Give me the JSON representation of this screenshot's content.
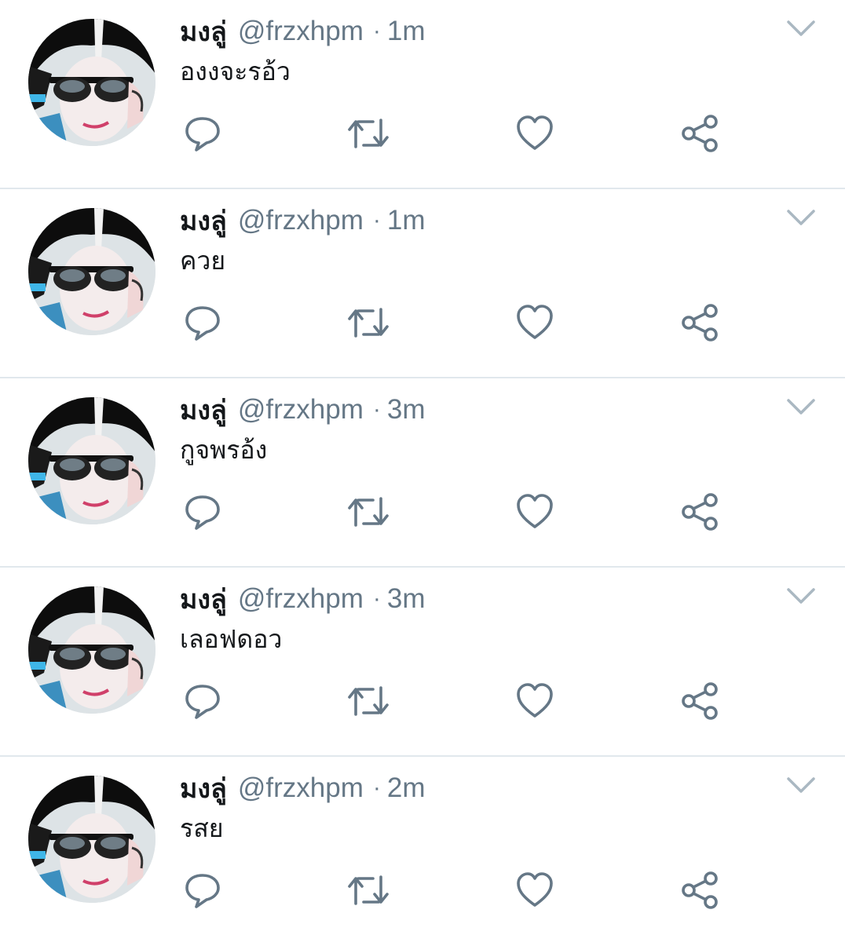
{
  "colors": {
    "name": "#14171a",
    "meta": "#657786",
    "icon": "#657786",
    "divider": "#e1e8ed",
    "caret": "#aab8c2"
  },
  "icons": {
    "reply": "reply-icon",
    "retweet": "retweet-icon",
    "like": "heart-icon",
    "share": "share-icon",
    "caret": "chevron-down-icon"
  },
  "tweets": [
    {
      "name": "มงลู่",
      "handle": "@frzxhpm",
      "separator": "·",
      "time": "1m",
      "text": "องงจะรอ้ว"
    },
    {
      "name": "มงลู่",
      "handle": "@frzxhpm",
      "separator": "·",
      "time": "1m",
      "text": "ควย"
    },
    {
      "name": "มงลู่",
      "handle": "@frzxhpm",
      "separator": "·",
      "time": "3m",
      "text": "กูจพรอ้ง"
    },
    {
      "name": "มงลู่",
      "handle": "@frzxhpm",
      "separator": "·",
      "time": "3m",
      "text": "เลอฟดอว"
    },
    {
      "name": "มงลู่",
      "handle": "@frzxhpm",
      "separator": "·",
      "time": "2m",
      "text": "รสย"
    }
  ]
}
